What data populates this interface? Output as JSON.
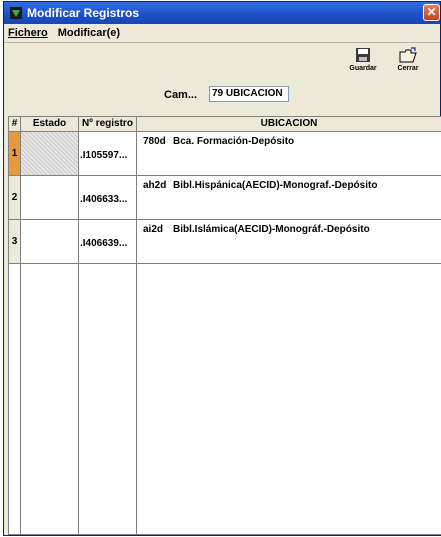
{
  "window": {
    "title": "Modificar Registros",
    "close_glyph": "✕"
  },
  "menu": {
    "items": [
      "Fichero",
      "Modificar(e)"
    ]
  },
  "toolbar": {
    "save_label": "Guardar",
    "close_label": "Cerrar"
  },
  "field": {
    "label": "Cam...",
    "value": "79 UBICACION"
  },
  "table": {
    "headers": [
      "#",
      "Estado",
      "Nº registro",
      "UBICACION"
    ],
    "rows": [
      {
        "num": "1",
        "estado": "",
        "registro": ".I105597...",
        "code": "780d",
        "ubicacion": "Bca. Formación-Depósito",
        "selected": true
      },
      {
        "num": "2",
        "estado": "",
        "registro": ".I406633...",
        "code": "ah2d",
        "ubicacion": "Bibl.Hispánica(AECID)-Monograf.-Depósito",
        "selected": false
      },
      {
        "num": "3",
        "estado": "",
        "registro": ".I406639...",
        "code": "ai2d",
        "ubicacion": "Bibl.Islámica(AECID)-Monográf.-Depósito",
        "selected": false
      }
    ]
  },
  "icons": {
    "app": "app-icon",
    "save": "floppy-disk-icon",
    "close": "open-folder-icon"
  },
  "colors": {
    "titlebar": "#1c4fc8",
    "selected_row_marker": "#e69a3c"
  }
}
